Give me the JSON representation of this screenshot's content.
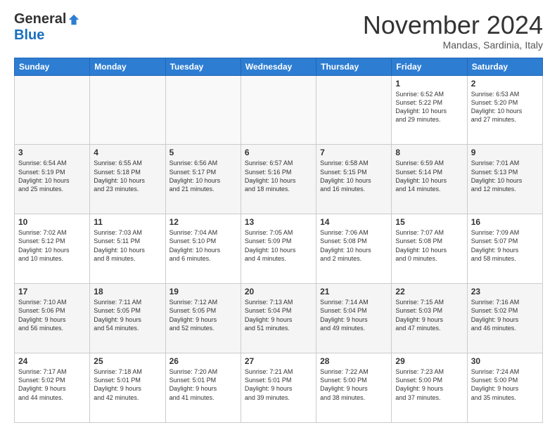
{
  "header": {
    "logo": {
      "general": "General",
      "blue": "Blue",
      "tagline": ""
    },
    "title": "November 2024",
    "location": "Mandas, Sardinia, Italy"
  },
  "weekdays": [
    "Sunday",
    "Monday",
    "Tuesday",
    "Wednesday",
    "Thursday",
    "Friday",
    "Saturday"
  ],
  "weeks": [
    [
      {
        "day": "",
        "info": ""
      },
      {
        "day": "",
        "info": ""
      },
      {
        "day": "",
        "info": ""
      },
      {
        "day": "",
        "info": ""
      },
      {
        "day": "",
        "info": ""
      },
      {
        "day": "1",
        "info": "Sunrise: 6:52 AM\nSunset: 5:22 PM\nDaylight: 10 hours\nand 29 minutes."
      },
      {
        "day": "2",
        "info": "Sunrise: 6:53 AM\nSunset: 5:20 PM\nDaylight: 10 hours\nand 27 minutes."
      }
    ],
    [
      {
        "day": "3",
        "info": "Sunrise: 6:54 AM\nSunset: 5:19 PM\nDaylight: 10 hours\nand 25 minutes."
      },
      {
        "day": "4",
        "info": "Sunrise: 6:55 AM\nSunset: 5:18 PM\nDaylight: 10 hours\nand 23 minutes."
      },
      {
        "day": "5",
        "info": "Sunrise: 6:56 AM\nSunset: 5:17 PM\nDaylight: 10 hours\nand 21 minutes."
      },
      {
        "day": "6",
        "info": "Sunrise: 6:57 AM\nSunset: 5:16 PM\nDaylight: 10 hours\nand 18 minutes."
      },
      {
        "day": "7",
        "info": "Sunrise: 6:58 AM\nSunset: 5:15 PM\nDaylight: 10 hours\nand 16 minutes."
      },
      {
        "day": "8",
        "info": "Sunrise: 6:59 AM\nSunset: 5:14 PM\nDaylight: 10 hours\nand 14 minutes."
      },
      {
        "day": "9",
        "info": "Sunrise: 7:01 AM\nSunset: 5:13 PM\nDaylight: 10 hours\nand 12 minutes."
      }
    ],
    [
      {
        "day": "10",
        "info": "Sunrise: 7:02 AM\nSunset: 5:12 PM\nDaylight: 10 hours\nand 10 minutes."
      },
      {
        "day": "11",
        "info": "Sunrise: 7:03 AM\nSunset: 5:11 PM\nDaylight: 10 hours\nand 8 minutes."
      },
      {
        "day": "12",
        "info": "Sunrise: 7:04 AM\nSunset: 5:10 PM\nDaylight: 10 hours\nand 6 minutes."
      },
      {
        "day": "13",
        "info": "Sunrise: 7:05 AM\nSunset: 5:09 PM\nDaylight: 10 hours\nand 4 minutes."
      },
      {
        "day": "14",
        "info": "Sunrise: 7:06 AM\nSunset: 5:08 PM\nDaylight: 10 hours\nand 2 minutes."
      },
      {
        "day": "15",
        "info": "Sunrise: 7:07 AM\nSunset: 5:08 PM\nDaylight: 10 hours\nand 0 minutes."
      },
      {
        "day": "16",
        "info": "Sunrise: 7:09 AM\nSunset: 5:07 PM\nDaylight: 9 hours\nand 58 minutes."
      }
    ],
    [
      {
        "day": "17",
        "info": "Sunrise: 7:10 AM\nSunset: 5:06 PM\nDaylight: 9 hours\nand 56 minutes."
      },
      {
        "day": "18",
        "info": "Sunrise: 7:11 AM\nSunset: 5:05 PM\nDaylight: 9 hours\nand 54 minutes."
      },
      {
        "day": "19",
        "info": "Sunrise: 7:12 AM\nSunset: 5:05 PM\nDaylight: 9 hours\nand 52 minutes."
      },
      {
        "day": "20",
        "info": "Sunrise: 7:13 AM\nSunset: 5:04 PM\nDaylight: 9 hours\nand 51 minutes."
      },
      {
        "day": "21",
        "info": "Sunrise: 7:14 AM\nSunset: 5:04 PM\nDaylight: 9 hours\nand 49 minutes."
      },
      {
        "day": "22",
        "info": "Sunrise: 7:15 AM\nSunset: 5:03 PM\nDaylight: 9 hours\nand 47 minutes."
      },
      {
        "day": "23",
        "info": "Sunrise: 7:16 AM\nSunset: 5:02 PM\nDaylight: 9 hours\nand 46 minutes."
      }
    ],
    [
      {
        "day": "24",
        "info": "Sunrise: 7:17 AM\nSunset: 5:02 PM\nDaylight: 9 hours\nand 44 minutes."
      },
      {
        "day": "25",
        "info": "Sunrise: 7:18 AM\nSunset: 5:01 PM\nDaylight: 9 hours\nand 42 minutes."
      },
      {
        "day": "26",
        "info": "Sunrise: 7:20 AM\nSunset: 5:01 PM\nDaylight: 9 hours\nand 41 minutes."
      },
      {
        "day": "27",
        "info": "Sunrise: 7:21 AM\nSunset: 5:01 PM\nDaylight: 9 hours\nand 39 minutes."
      },
      {
        "day": "28",
        "info": "Sunrise: 7:22 AM\nSunset: 5:00 PM\nDaylight: 9 hours\nand 38 minutes."
      },
      {
        "day": "29",
        "info": "Sunrise: 7:23 AM\nSunset: 5:00 PM\nDaylight: 9 hours\nand 37 minutes."
      },
      {
        "day": "30",
        "info": "Sunrise: 7:24 AM\nSunset: 5:00 PM\nDaylight: 9 hours\nand 35 minutes."
      }
    ]
  ]
}
